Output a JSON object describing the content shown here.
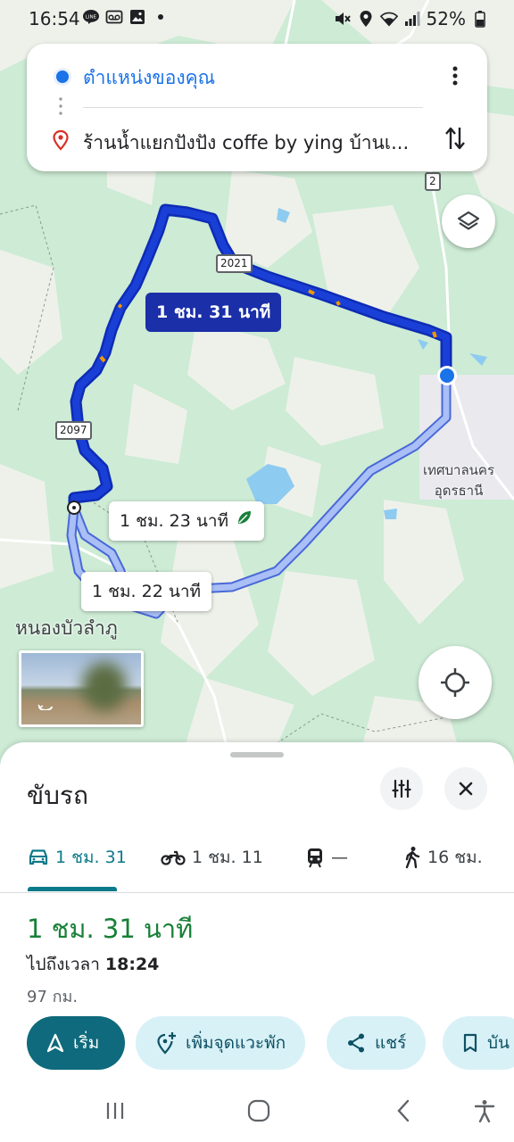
{
  "status_bar": {
    "time": "16:54",
    "battery": "52%",
    "left_icons": [
      "line-icon",
      "voicemail-icon",
      "image-icon",
      "dot-icon"
    ],
    "right_icons": [
      "mute-icon",
      "location-icon",
      "wifi-icon",
      "signal-icon",
      "battery-icon"
    ]
  },
  "route_card": {
    "origin": "ตำแหน่งของคุณ",
    "destination": "ร้านน้ำแยกปังปัง coffe by ying บ้านเ..."
  },
  "map": {
    "route_primary_time": "1 ชม. 31 นาที",
    "route_alt1_time": "1 ชม. 23 นาที",
    "route_alt2_time": "1 ชม. 22 นาที",
    "shield_2021": "2021",
    "shield_2097": "2097",
    "shield_2": "2",
    "city_label_line1": "เทศบาลนคร",
    "city_label_line2": "อุดรธานี",
    "place_label": "หนองบัวลำภู",
    "colors": {
      "primary_route": "#1a3fd6",
      "alt_route": "#9db4f2",
      "land": "#e8f1e6",
      "park": "#cdebd5",
      "water": "#8ecbf0"
    }
  },
  "sheet": {
    "title": "ขับรถ",
    "tabs": [
      {
        "icon": "car-icon",
        "label": "1 ชม. 31"
      },
      {
        "icon": "motorcycle-icon",
        "label": "1 ชม. 11"
      },
      {
        "icon": "train-icon",
        "label": "—"
      },
      {
        "icon": "walk-icon",
        "label": "16 ชม."
      }
    ],
    "duration": "1 ชม. 31 นาที",
    "arrival_prefix": "ไปถึงเวลา",
    "arrival_time": "18:24",
    "distance": "97 กม.",
    "buttons": {
      "start": "เริ่ม",
      "add_stop": "เพิ่มจุดแวะพัก",
      "share": "แชร์",
      "save": "บัน"
    },
    "colors": {
      "accent": "#0b7a8a",
      "duration": "#188038",
      "chip_bg": "#d8f1f7"
    }
  }
}
